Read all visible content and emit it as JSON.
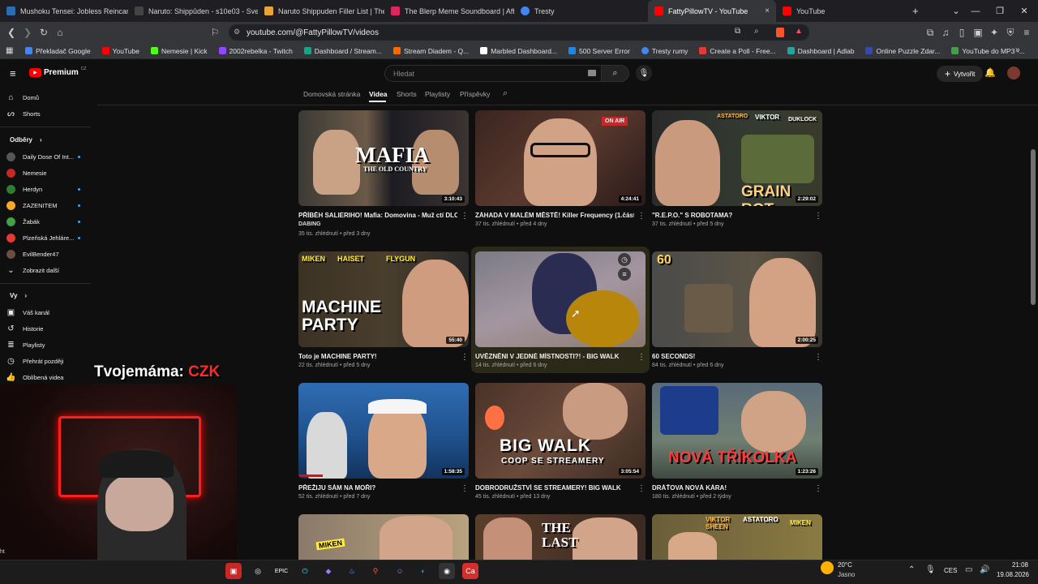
{
  "browser": {
    "tabs": [
      {
        "title": "Mushoku Tensei: Jobless Reincarnat",
        "color": "#2b6cb0"
      },
      {
        "title": "Naruto: Shippûden - s10e03 - Svets",
        "color": "#444"
      },
      {
        "title": "Naruto Shippuden Filler List | The U",
        "color": "#e8a33b"
      },
      {
        "title": "The Blerp Meme Soundboard | Affili",
        "color": "#e0245e"
      },
      {
        "title": "Tresty",
        "color": "#4285f4"
      },
      {
        "title": "FattyPillowTV - YouTube",
        "color": "#ff0000",
        "close": "×"
      },
      {
        "title": "YouTube",
        "color": "#ff0000"
      }
    ],
    "new_tab": "+",
    "url": "youtube.com/@FattyPillowTV/videos",
    "bookmarks": [
      {
        "label": "Překladač Google",
        "color": "#4285f4"
      },
      {
        "label": "YouTube",
        "color": "#ff0000"
      },
      {
        "label": "Nemesie | Kick",
        "color": "#53fc18"
      },
      {
        "label": "2002rebelka - Twitch",
        "color": "#9146ff"
      },
      {
        "label": "Dashboard / Stream...",
        "color": "#17a589"
      },
      {
        "label": "Stream Diadem - Q...",
        "color": "#ff6a00"
      },
      {
        "label": "Marbled Dashboard...",
        "color": "#ffffff"
      },
      {
        "label": "500 Server Error",
        "color": "#1e88e5"
      },
      {
        "label": "Tresty rumy",
        "color": "#4285f4"
      },
      {
        "label": "Create a Poll - Free...",
        "color": "#e53935"
      },
      {
        "label": "Dashboard | Adlab",
        "color": "#26a69a"
      },
      {
        "label": "Online Puzzle Zdar...",
        "color": "#3949ab"
      },
      {
        "label": "YouTube do MP3 -...",
        "color": "#43a047"
      }
    ]
  },
  "youtube": {
    "logo": "Premium",
    "logo_region": "CZ",
    "search_placeholder": "Hledat",
    "create_label": "Vytvořit",
    "channel_tabs": [
      "Domovská stránka",
      "Videa",
      "Shorts",
      "Playlisty",
      "Příspěvky"
    ],
    "sidebar": {
      "home": "Domů",
      "shorts": "Shorts",
      "subs_header": "Odběry",
      "subs": [
        {
          "name": "Daily Dose Of Int...",
          "color": "#333",
          "dot": true
        },
        {
          "name": "Nemesie",
          "color": "#c62828",
          "dot": false
        },
        {
          "name": "Herdyn",
          "color": "#2e7d32",
          "dot": true
        },
        {
          "name": "ZAZENITEM",
          "color": "#f9a825",
          "dot": true
        },
        {
          "name": "Žabák",
          "color": "#43a047",
          "dot": true
        },
        {
          "name": "Plzeňská Jehláre...",
          "color": "#e53935",
          "dot": true
        },
        {
          "name": "EvilBender47",
          "color": "#6d4c41",
          "dot": false
        }
      ],
      "show_more": "Zobrazit další",
      "you_header": "Vy",
      "you_items": [
        "Váš kanál",
        "Historie",
        "Playlisty",
        "Přehrát později",
        "Oblíbená videa"
      ]
    },
    "videos": [
      {
        "title": "PŘÍBĚH SALIERIHO! Mafia: Domovina - Muž ctí DLC | cz",
        "sub": "DABING",
        "views": "35 tis. zhlédnutí",
        "age": "před 3 dny",
        "duration": "3:10:43",
        "thumb_text": "MAFIA",
        "thumb_sub": "THE OLD COUNTRY"
      },
      {
        "title": "ZÁHADA V MALÉM MĚSTĚ! Killer Frequency (1.část)",
        "views": "37 tis. zhlédnutí",
        "age": "před 4 dny",
        "duration": "4:24:41",
        "thumb_text": "ON AIR"
      },
      {
        "title": "\"R.E.P.O.\" S ROBOTAMA?",
        "views": "37 tis. zhlédnutí",
        "age": "před 5 dny",
        "duration": "2:29:02",
        "thumb_text": "GRAIN ROT",
        "thumb_names": [
          "ASTATORO",
          "VIKTOR",
          "DUKLOCK"
        ]
      },
      {
        "title": "Toto je MACHINE PARTY!",
        "views": "22 tis. zhlédnutí",
        "age": "před 5 dny",
        "duration": "55:40",
        "thumb_text": "MACHINE PARTY",
        "thumb_names": [
          "MIKEN",
          "HAISET",
          "FLYGUN"
        ]
      },
      {
        "title": "UVĚZNĚNI V JEDNÉ MÍSTNOSTI?! - BIG WALK",
        "views": "14 tis. zhlédnutí",
        "age": "před 6 dny",
        "duration": ""
      },
      {
        "title": "60 SECONDS!",
        "views": "84 tis. zhlédnutí",
        "age": "před 6 dny",
        "duration": "2:00:25",
        "thumb_text": "60"
      },
      {
        "title": "PŘEŽIJU SÁM NA MOŘI?",
        "views": "52 tis. zhlédnutí",
        "age": "před 7 dny",
        "duration": "1:58:35"
      },
      {
        "title": "DOBRODRUŽSTVÍ SE STREAMERY! BIG WALK",
        "views": "45 tis. zhlédnutí",
        "age": "před 13 dny",
        "duration": "3:05:54",
        "thumb_text": "BIG WALK",
        "thumb_sub": "COOP SE STREAMERY"
      },
      {
        "title": "DRÁŤOVA NOVÁ KÁRA!",
        "views": "180 tis. zhlédnutí",
        "age": "před 2 týdny",
        "duration": "1:23:26",
        "thumb_text": "NOVÁ TŘÍKOLKA"
      },
      {
        "title": "",
        "thumb_text": "MIKEN"
      },
      {
        "title": "",
        "thumb_text": "THE LAST"
      },
      {
        "title": "",
        "thumb_names": [
          "VIKTOR SHEEN",
          "ASTATORO",
          "MIKEN"
        ]
      }
    ],
    "bullet": " • "
  },
  "overlay": {
    "label": "Tvojemáma:",
    "currency": "CZK"
  },
  "taskbar": {
    "weather_temp": "20°C",
    "weather_desc": "Jasno",
    "lang": "CES",
    "time": "21:08",
    "date": "19.08.2026",
    "edge_text": "ht"
  }
}
